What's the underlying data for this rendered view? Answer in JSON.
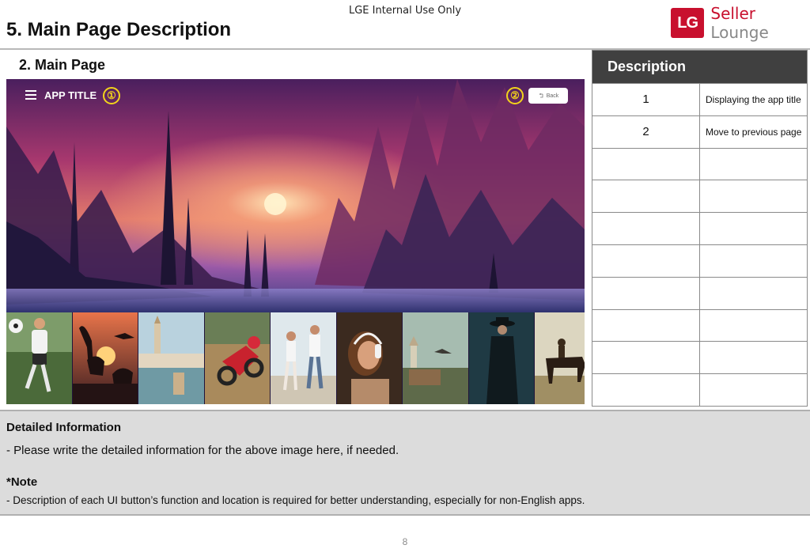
{
  "header": {
    "internal_label": "LGE Internal Use Only",
    "title": "5. Main Page Description",
    "logo": {
      "mark": "LG",
      "seller": "Seller",
      "lounge": "Lounge"
    }
  },
  "section": {
    "title": "2. Main Page"
  },
  "screen": {
    "app_title": "APP TITLE",
    "marker_1": "①",
    "marker_2": "②",
    "back_label": "Back",
    "back_icon": "back-arrow-icon",
    "menu_icon": "hamburger-menu-icon",
    "thumbnails": [
      "soccer-player",
      "dinosaurs-sunset",
      "venice-canal",
      "motocross-rider",
      "couple-walking",
      "woman-headphones",
      "bird-over-village",
      "cowboy-night",
      "horse-rider"
    ]
  },
  "description": {
    "header": "Description",
    "rows": [
      {
        "num": "1",
        "text": "Displaying the app title"
      },
      {
        "num": "2",
        "text": "Move to previous page"
      },
      {
        "num": "",
        "text": ""
      },
      {
        "num": "",
        "text": ""
      },
      {
        "num": "",
        "text": ""
      },
      {
        "num": "",
        "text": ""
      },
      {
        "num": "",
        "text": ""
      },
      {
        "num": "",
        "text": ""
      },
      {
        "num": "",
        "text": ""
      },
      {
        "num": "",
        "text": ""
      }
    ]
  },
  "info": {
    "title": "Detailed Information",
    "text": "- Please write the detailed information for the above image here, if needed.",
    "note_title": "*Note",
    "note_text": "- Description of each UI button’s function and location is required for better understanding, especially for non-English apps."
  },
  "footer": {
    "page_number": "8"
  },
  "colors": {
    "brand_red": "#c8102e",
    "marker_yellow": "#f2d31b",
    "table_header": "#404040",
    "info_bg": "#dcdcdc"
  }
}
